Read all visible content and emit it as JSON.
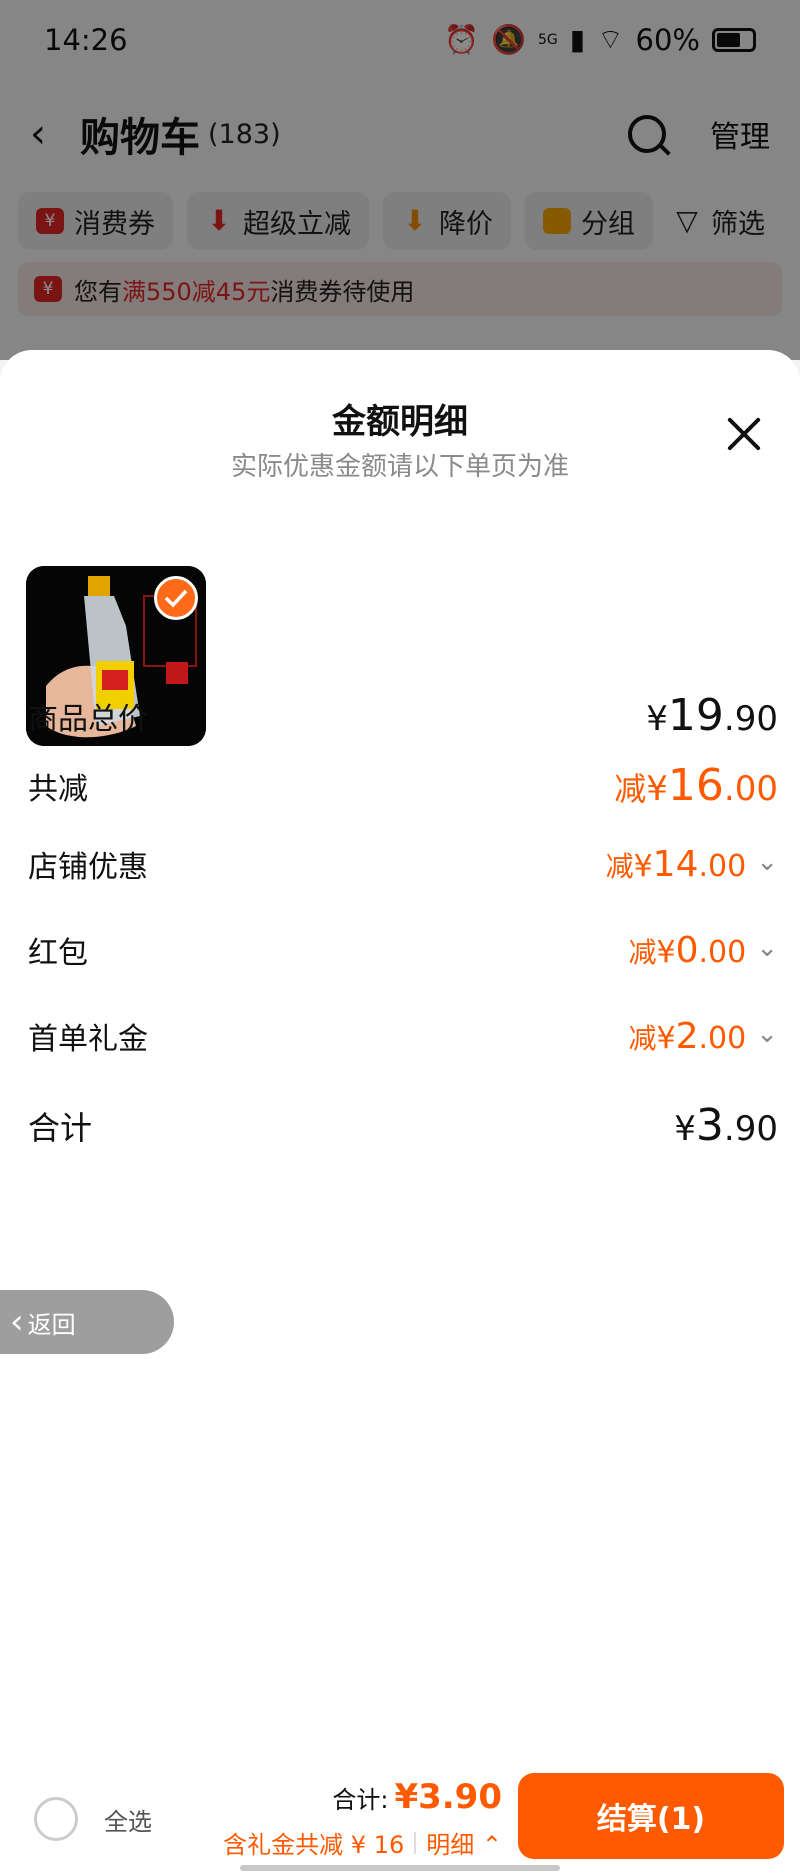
{
  "status_bar": {
    "time": "14:26",
    "battery": "60%",
    "network": "5G"
  },
  "nav": {
    "title": "购物车",
    "count": "(183)",
    "manage": "管理"
  },
  "chips": [
    {
      "label": "消费券",
      "icon": "coupon-icon"
    },
    {
      "label": "超级立减",
      "icon": "arrow-down-icon"
    },
    {
      "label": "降价",
      "icon": "price-down-icon"
    },
    {
      "label": "分组",
      "icon": "folder-icon"
    },
    {
      "label": "筛选",
      "icon": "filter-icon"
    }
  ],
  "coupon_banner": {
    "prefix": "您有",
    "highlight": "满550减45元",
    "suffix": "消费券待使用"
  },
  "sheet": {
    "title": "金额明细",
    "subtitle": "实际优惠金额请以下单页为准",
    "product": {
      "image": "liquor-bottle-image",
      "selected": true
    }
  },
  "breakdown": {
    "total_price": {
      "label": "商品总价",
      "yen": "¥",
      "int": "19",
      "dec": ".90"
    },
    "total_discount": {
      "label": "共减",
      "prefix": "减",
      "yen": "¥",
      "int": "16",
      "dec": ".00"
    },
    "shop_discount": {
      "label": "店铺优惠",
      "prefix": "减",
      "yen": "¥",
      "int": "14",
      "dec": ".00"
    },
    "red_packet": {
      "label": "红包",
      "prefix": "减",
      "yen": "¥",
      "int": "0",
      "dec": ".00"
    },
    "first_order_gift": {
      "label": "首单礼金",
      "prefix": "减",
      "yen": "¥",
      "int": "2",
      "dec": ".00"
    },
    "sum": {
      "label": "合计",
      "yen": "¥",
      "int": "3",
      "dec": ".90"
    }
  },
  "back_pill": {
    "label": "返回"
  },
  "bottom_bar": {
    "select_all": "全选",
    "total_label": "合计:",
    "total_value": "¥3.90",
    "gift_discount": "含礼金共减 ¥ 16",
    "detail": "明细",
    "checkout": "结算(1)"
  },
  "colors": {
    "accent": "#ff5a00",
    "coupon_red": "#e02626"
  }
}
